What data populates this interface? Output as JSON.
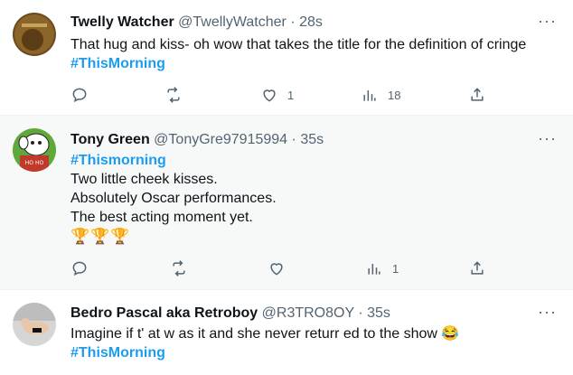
{
  "tweets": [
    {
      "name": "Twelly Watcher",
      "handle": "@TwellyWatcher",
      "separator": "·",
      "time": "28s",
      "lines": [
        "That hug and kiss- oh wow that takes the title for the definition of cringe"
      ],
      "hashtag": "#ThisMorning",
      "stats": {
        "replies": "",
        "retweets": "",
        "likes": "1",
        "views": "18"
      }
    },
    {
      "name": "Tony Green",
      "handle": "@TonyGre97915994",
      "separator": "·",
      "time": "35s",
      "hashtag": "#Thismorning",
      "lines": [
        "Two little cheek kisses.",
        "Absolutely Oscar performances.",
        "The best acting moment yet."
      ],
      "emoji": "🏆🏆🏆",
      "stats": {
        "replies": "",
        "retweets": "",
        "likes": "",
        "views": "1"
      }
    },
    {
      "name": "Bedro Pascal aka Retroboy",
      "handle": "@R3TRO8OY",
      "separator": "·",
      "time": "35s",
      "lines": [
        "Imagine if t' at w as it and she never returr ed to the show 😂"
      ],
      "hashtag": "#ThisMorning"
    }
  ],
  "icons": {
    "reply": "reply-icon",
    "retweet": "retweet-icon",
    "like": "heart-icon",
    "views": "views-icon",
    "share": "share-icon",
    "more": "more-icon"
  },
  "colors": {
    "hashtag": "#1d9bf0",
    "secondary_text": "#536471",
    "highlight_bg": "#f7f9f9"
  }
}
